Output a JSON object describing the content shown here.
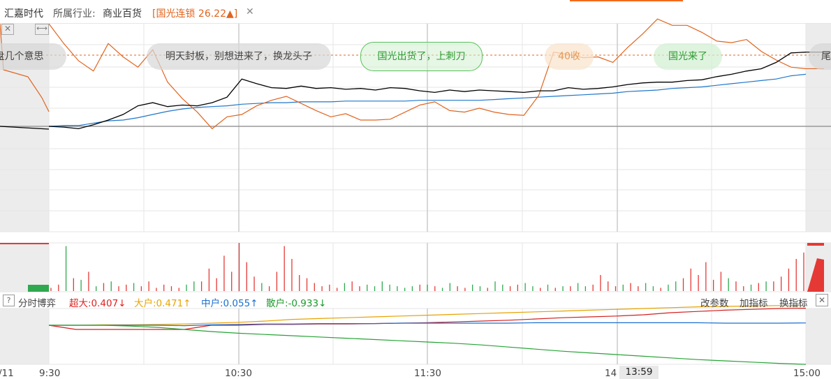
{
  "header": {
    "stock_name": "汇嘉时代",
    "industry_label": "所属行业:",
    "industry_value": "商业百货",
    "related_stock": "[国光连锁 26.22▲]",
    "close_icon": "close-icon"
  },
  "annotations": [
    {
      "text": "盘几个意思",
      "style": "gray"
    },
    {
      "text": "明天封板，别想进来了，换龙头子",
      "style": "gray"
    },
    {
      "text": "国光出货了，上刺刀",
      "style": "green"
    },
    {
      "text": "40收",
      "style": "orange"
    },
    {
      "text": "国光来了",
      "style": "green-soft"
    },
    {
      "text": "尾",
      "style": "gray"
    }
  ],
  "indicator_panel": {
    "help": "?",
    "title": "分时博弈",
    "stats": {
      "super_large": "超大:0.407↓",
      "large": "大户:0.471↑",
      "medium": "中户:0.055↑",
      "retail": "散户:-0.933↓"
    },
    "buttons": {
      "params": "改参数",
      "add": "加指标",
      "switch": "换指标",
      "close": "✕"
    }
  },
  "time_axis": {
    "date": "/11",
    "labels": [
      "9:30",
      "10:30",
      "11:30",
      "14",
      "15:00"
    ],
    "cursor": "13:59"
  },
  "colors": {
    "price": "#000000",
    "avg_price": "#1f77c9",
    "related": "#e0641e",
    "up": "#e53935",
    "down": "#2fa84f",
    "super": "#d32020",
    "large": "#e6a200",
    "medium": "#1a6fd0",
    "retail": "#27a336",
    "grid": "#e6e6e6",
    "shade": "#ececec"
  },
  "chart_data": [
    {
      "type": "line",
      "series": [
        {
          "values": [
            0,
            -0.1,
            -0.3,
            0.2,
            0.8,
            1.5,
            2.6,
            3.0,
            2.5,
            2.7,
            2.6,
            3.0,
            3.7,
            6.0,
            5.4,
            4.9,
            4.8,
            5.1,
            4.8,
            4.9,
            4.7,
            4.8,
            4.6,
            4.9,
            4.8,
            4.5,
            4.3,
            4.6,
            4.4,
            4.6,
            4.5,
            4.4,
            4.3,
            4.5,
            4.5,
            4.9,
            4.7,
            4.8,
            5.0,
            5.3,
            5.5,
            5.6,
            5.6,
            5.8,
            5.9,
            6.3,
            6.6,
            7.0,
            7.3,
            8.1,
            9.3,
            9.4
          ]
        },
        {
          "values": [
            0,
            0.1,
            0.1,
            0.4,
            0.7,
            0.8,
            1.1,
            1.5,
            1.9,
            2.2,
            2.4,
            2.5,
            2.6,
            2.8,
            2.9,
            3.0,
            3.0,
            3.1,
            3.1,
            3.1,
            3.2,
            3.2,
            3.2,
            3.2,
            3.2,
            3.3,
            3.3,
            3.3,
            3.3,
            3.3,
            3.4,
            3.5,
            3.6,
            3.7,
            3.8,
            3.9,
            4.0,
            4.1,
            4.2,
            4.4,
            4.5,
            4.6,
            4.8,
            4.9,
            5.0,
            5.2,
            5.4,
            5.6,
            5.8,
            6.0,
            6.4,
            6.6
          ]
        },
        {
          "values": [
            13.0,
            10.5,
            8.3,
            7.0,
            10.5,
            8.8,
            7.5,
            9.7,
            5.6,
            3.5,
            1.8,
            -0.3,
            1.2,
            1.5,
            2.6,
            3.3,
            3.8,
            2.9,
            2.0,
            1.2,
            1.6,
            0.8,
            0.8,
            0.9,
            1.8,
            2.7,
            3.1,
            2.0,
            1.8,
            2.3,
            1.8,
            1.5,
            1.4,
            3.9,
            9.4,
            9.1,
            8.7,
            8.8,
            8.1,
            10.0,
            11.7,
            13.6,
            12.8,
            12.8,
            11.9,
            10.8,
            10.6,
            11.0,
            9.5,
            8.4,
            7.5,
            7.3
          ]
        }
      ]
    },
    {
      "type": "bar",
      "series": [
        {
          "values": [
            2,
            4,
            1,
            8,
            3,
            12,
            2,
            5,
            2,
            3,
            4,
            2,
            3,
            6,
            2,
            4,
            3,
            2,
            2,
            1,
            6,
            14,
            8,
            22,
            12,
            30,
            18,
            9,
            4,
            3,
            12,
            28,
            20,
            10,
            8,
            5,
            3,
            4,
            2,
            3,
            6,
            3,
            2,
            2,
            3,
            2,
            1,
            1,
            2,
            4,
            2,
            3,
            1,
            2,
            3,
            2,
            2,
            1,
            2,
            3,
            2,
            3,
            4,
            2,
            1,
            2,
            3,
            2,
            1,
            3,
            2,
            2,
            4,
            10,
            6,
            3,
            2,
            5,
            3,
            2,
            1,
            2,
            3,
            4,
            8,
            14,
            10,
            18,
            7,
            12,
            4,
            6,
            3,
            2,
            5,
            3,
            6,
            9,
            14,
            20,
            24
          ]
        },
        {
          "values": [
            1,
            3,
            28,
            5,
            7,
            4,
            3,
            2,
            6,
            3,
            2,
            5,
            3,
            2,
            2,
            1,
            3,
            2,
            4,
            6,
            3,
            8,
            5,
            3,
            2,
            4,
            3,
            2,
            5,
            3,
            2,
            4,
            3,
            6,
            8,
            3,
            2,
            4,
            2,
            5,
            3,
            2,
            4,
            3,
            6,
            4,
            3,
            2,
            3,
            2,
            4,
            3,
            2,
            5,
            3,
            2,
            4,
            3,
            2,
            6,
            4,
            3,
            2,
            5,
            3,
            2,
            4,
            2,
            3,
            2,
            5,
            3,
            4,
            2,
            3,
            2,
            4,
            3,
            2,
            5,
            3,
            2,
            4,
            6,
            3,
            2,
            5,
            4,
            3,
            12,
            8,
            5,
            3,
            4,
            2,
            6,
            3,
            4,
            8,
            6,
            10
          ]
        }
      ]
    },
    {
      "type": "line",
      "series": [
        {
          "name": "超大",
          "values": [
            0,
            -0.1,
            -0.1,
            -0.1,
            -0.1,
            -0.1,
            0,
            0,
            0.02,
            0.02,
            0.03,
            0.03,
            0.04,
            0.05,
            0.06,
            0.08,
            0.1,
            0.12,
            0.15,
            0.18,
            0.2,
            0.22,
            0.25,
            0.3,
            0.33,
            0.36,
            0.38,
            0.4,
            0.407
          ]
        },
        {
          "name": "大户",
          "values": [
            0,
            0,
            0.01,
            0.01,
            0.02,
            0.03,
            0.05,
            0.07,
            0.1,
            0.14,
            0.16,
            0.18,
            0.2,
            0.22,
            0.24,
            0.26,
            0.28,
            0.3,
            0.32,
            0.34,
            0.36,
            0.38,
            0.4,
            0.42,
            0.44,
            0.45,
            0.46,
            0.47,
            0.471
          ]
        },
        {
          "name": "中户",
          "values": [
            0,
            0,
            0,
            0,
            0,
            -0.01,
            0.01,
            0.02,
            0.03,
            0.03,
            0.04,
            0.04,
            0.04,
            0.05,
            0.05,
            0.05,
            0.05,
            0.05,
            0.06,
            0.06,
            0.06,
            0.06,
            0.06,
            0.06,
            0.06,
            0.05,
            0.05,
            0.05,
            0.055
          ]
        },
        {
          "name": "散户",
          "values": [
            0,
            0,
            0,
            -0.02,
            -0.05,
            -0.1,
            -0.15,
            -0.19,
            -0.22,
            -0.25,
            -0.28,
            -0.31,
            -0.34,
            -0.37,
            -0.4,
            -0.43,
            -0.47,
            -0.52,
            -0.57,
            -0.62,
            -0.66,
            -0.7,
            -0.74,
            -0.78,
            -0.82,
            -0.85,
            -0.88,
            -0.91,
            -0.933
          ]
        }
      ]
    }
  ]
}
